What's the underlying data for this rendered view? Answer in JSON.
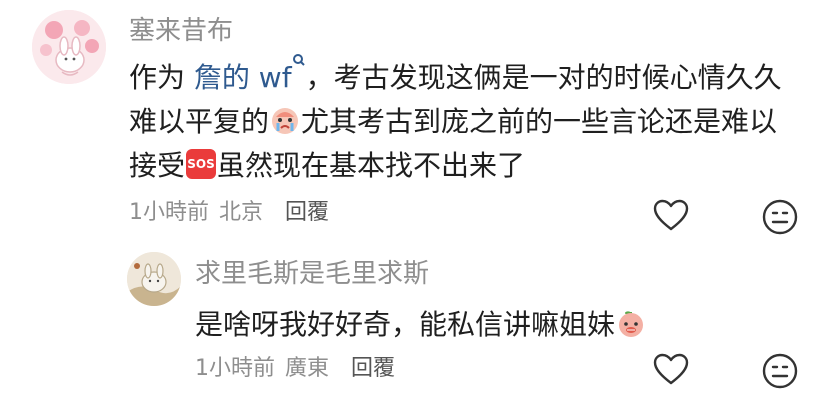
{
  "comment": {
    "username": "塞来昔布",
    "prefix": "作为 ",
    "mention": "詹的 wf",
    "text_line1": "，考古发现这俩是一对的时候心情久久",
    "text_line2a": "难以平复的",
    "text_line2b": "尤其考古到庞之前的一些言论还是难以",
    "text_line3a": "接受",
    "sos": "SOS",
    "text_line3b": "虽然现在基本找不出来了",
    "time": "1小時前",
    "location": "北京",
    "reply_label": "回覆"
  },
  "reply": {
    "username": "求里毛斯是毛里求斯",
    "text": "是啥呀我好好奇，能私信讲嘛姐妹",
    "time": "1小時前",
    "location": "廣東",
    "reply_label": "回覆"
  },
  "colors": {
    "mention": "#2f5a8f",
    "meta": "#8e8e8e",
    "sos": "#ea3b3b"
  }
}
